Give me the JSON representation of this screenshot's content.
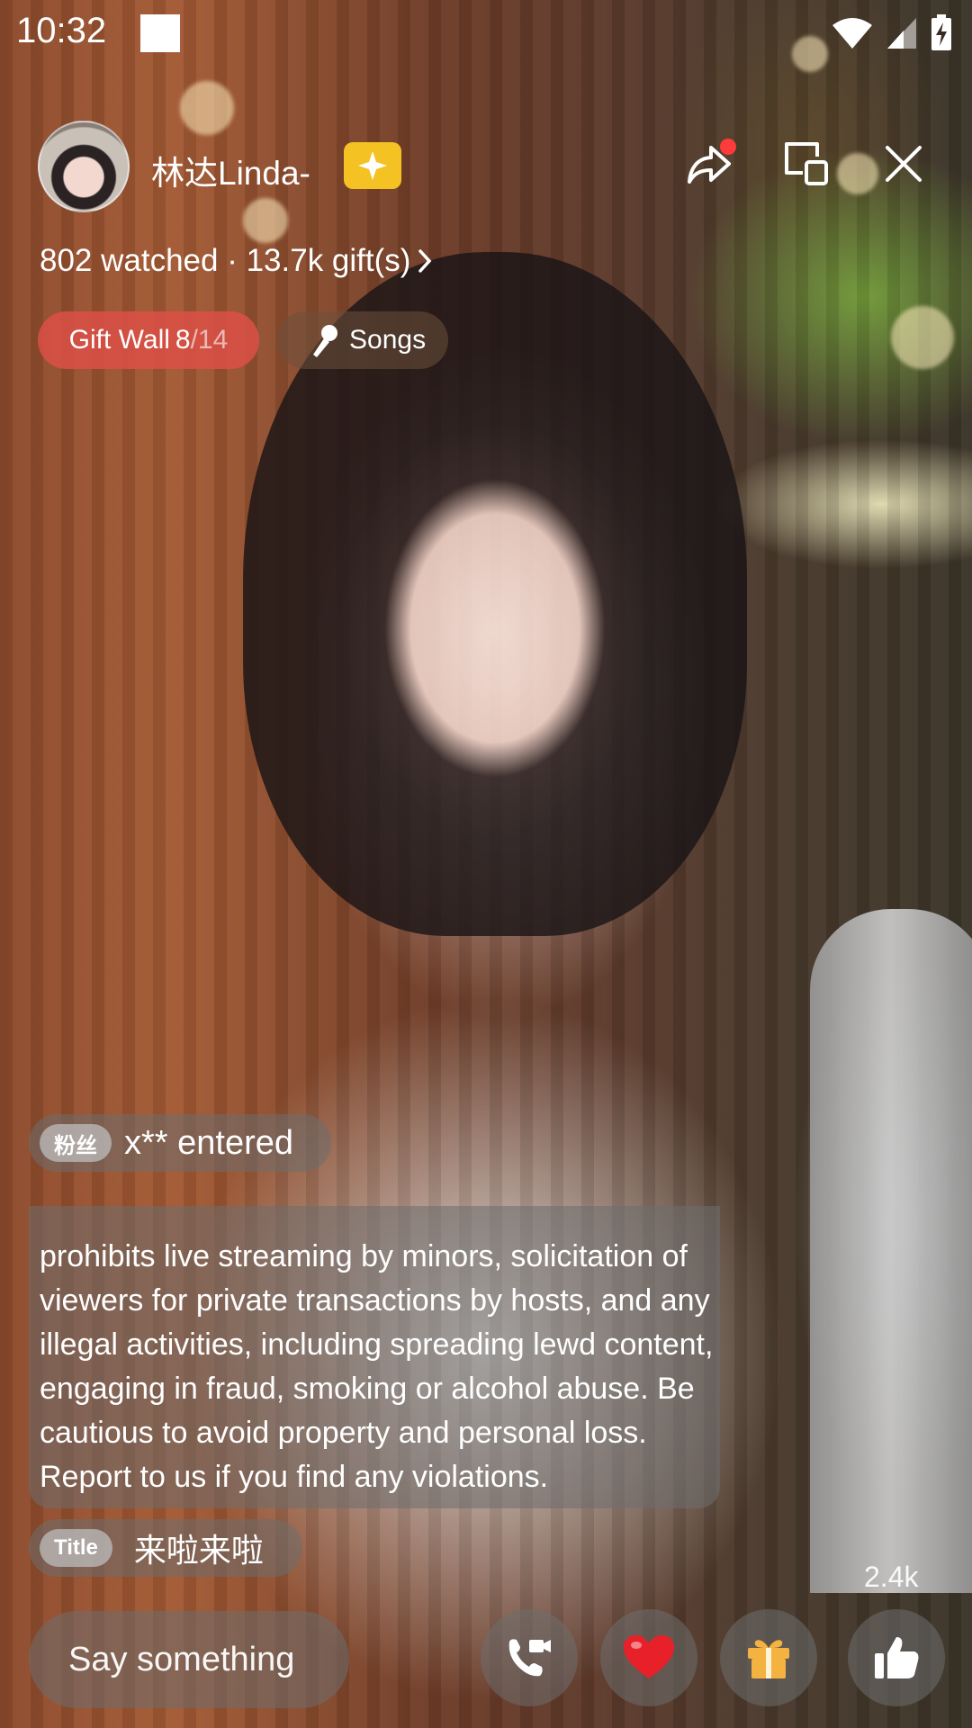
{
  "status_bar": {
    "time": "10:32"
  },
  "header": {
    "host_name": "林达Linda-",
    "stats": "802 watched · 13.7k gift(s)",
    "icons": [
      "share-icon",
      "screen-cast-icon",
      "close-icon"
    ]
  },
  "chips": {
    "gift_wall_label": "Gift Wall",
    "gift_wall_current": "8",
    "gift_wall_total": "/14",
    "songs_label": "Songs"
  },
  "chat": {
    "entered_badge": "粉丝",
    "entered_text": "x** entered",
    "notice": "prohibits live streaming by minors, solicitation of viewers for private transactions by hosts, and any illegal activities, including spreading lewd content, engaging in fraud, smoking or alcohol abuse. Be cautious to avoid property and personal loss. Report to us if you find any violations.",
    "title_tag": "Title",
    "title_text": "来啦来啦"
  },
  "bottom_bar": {
    "input_placeholder": "Say something",
    "like_count": "2.4k",
    "buttons": [
      "video-call-icon",
      "heart-icon",
      "gift-icon",
      "thumbs-up-icon"
    ]
  },
  "colors": {
    "gift_wall_chip": "#dc5046",
    "badge_yellow": "#f4c222",
    "share_dot": "#ff3b3b",
    "heart": "#e8202a",
    "gift": "#f4b240"
  }
}
